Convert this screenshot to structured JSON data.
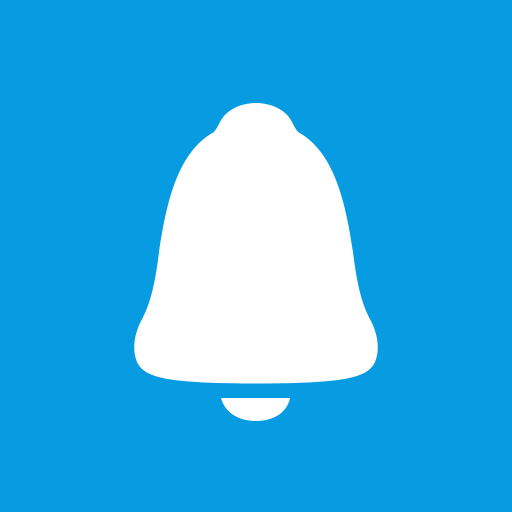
{
  "app_icon": {
    "icon_name": "bell-icon",
    "background_color": "#079be1",
    "glyph_color": "#ffffff"
  }
}
